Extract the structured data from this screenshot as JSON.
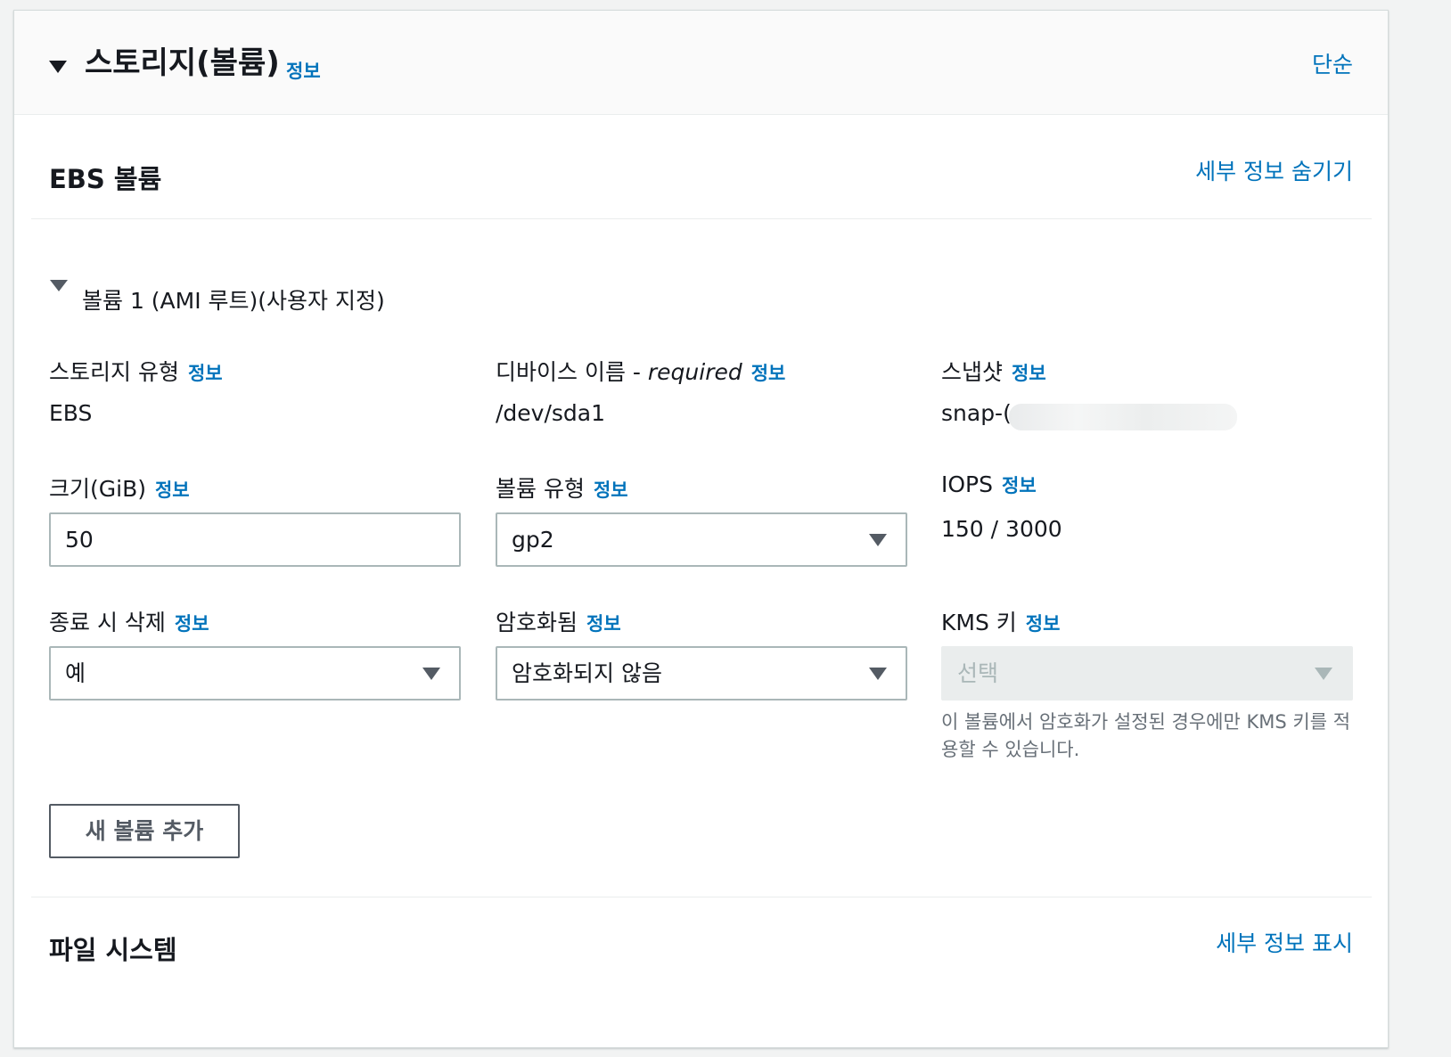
{
  "header": {
    "title": "스토리지(볼륨)",
    "info": "정보",
    "mode_link": "단순"
  },
  "ebs": {
    "title": "EBS 볼륨",
    "toggle_link": "세부 정보 숨기기"
  },
  "volume": {
    "title": "볼륨 1 (AMI 루트)(사용자 지정)",
    "storage_type": {
      "label": "스토리지 유형",
      "info": "정보",
      "value": "EBS"
    },
    "device_name": {
      "label": "디바이스 이름 - ",
      "label_italic": "required",
      "info": "정보",
      "value": "/dev/sda1"
    },
    "snapshot": {
      "label": "스냅샷",
      "info": "정보",
      "value": "snap-("
    },
    "size": {
      "label": "크기(GiB)",
      "info": "정보",
      "value": "50"
    },
    "volume_type": {
      "label": "볼륨 유형",
      "info": "정보",
      "value": "gp2"
    },
    "iops": {
      "label": "IOPS",
      "info": "정보",
      "value": "150 / 3000"
    },
    "delete_on_termination": {
      "label": "종료 시 삭제",
      "info": "정보",
      "value": "예"
    },
    "encrypted": {
      "label": "암호화됨",
      "info": "정보",
      "value": "암호화되지 않음"
    },
    "kms_key": {
      "label": "KMS 키",
      "info": "정보",
      "placeholder": "선택",
      "help": "이 볼륨에서 암호화가 설정된 경우에만 KMS 키를 적용할 수 있습니다."
    }
  },
  "add_volume_button": "새 볼륨 추가",
  "filesystem": {
    "title": "파일 시스템",
    "toggle_link": "세부 정보 표시"
  }
}
